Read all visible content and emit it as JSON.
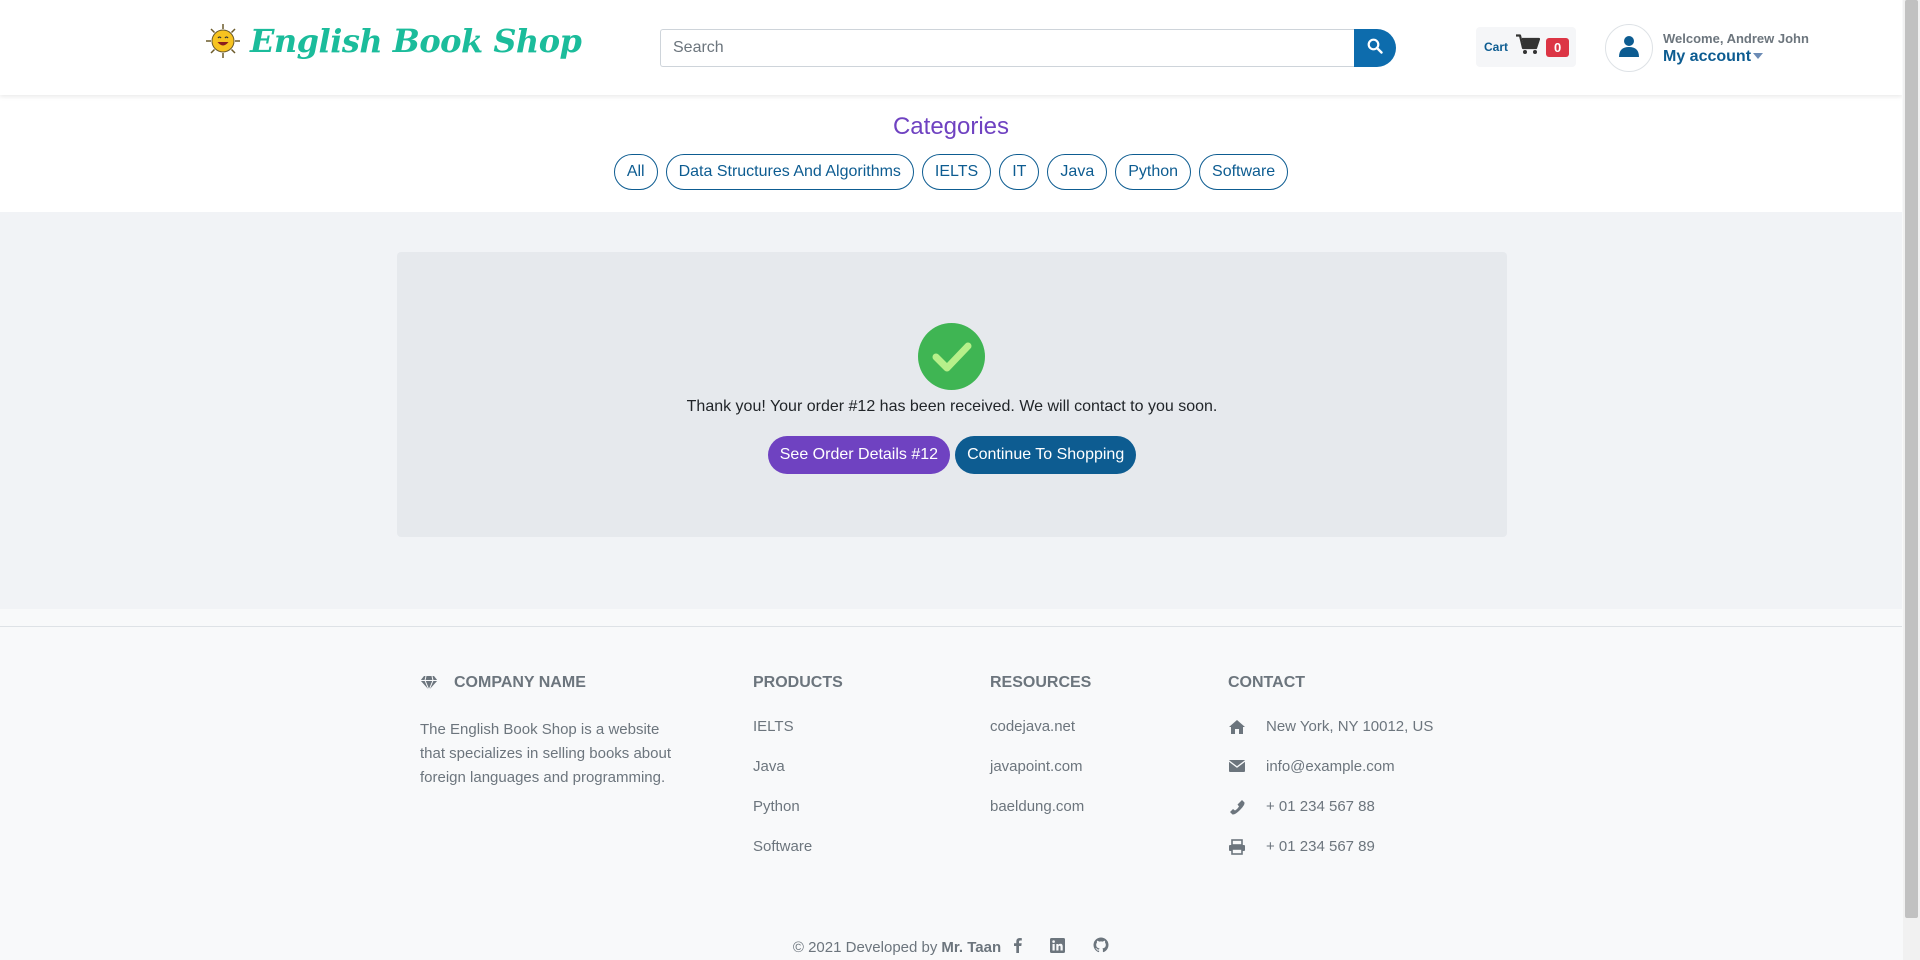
{
  "header": {
    "brand": "English Book Shop",
    "search_placeholder": "Search",
    "cart_label": "Cart",
    "cart_count": "0",
    "welcome": "Welcome, Andrew John",
    "my_account": "My account"
  },
  "categories": {
    "title": "Categories",
    "items": [
      "All",
      "Data Structures And Algorithms",
      "IELTS",
      "IT",
      "Java",
      "Python",
      "Software"
    ]
  },
  "confirmation": {
    "message": "Thank you! Your order #12 has been received. We will contact to you soon.",
    "details_button": "See Order Details #12",
    "continue_button": "Continue To Shopping"
  },
  "footer": {
    "company_heading": "COMPANY NAME",
    "company_text": "The English Book Shop is a website that specializes in selling books about foreign languages and programming.",
    "products_heading": "PRODUCTS",
    "products": [
      "IELTS",
      "Java",
      "Python",
      "Software"
    ],
    "resources_heading": "RESOURCES",
    "resources": [
      "codejava.net",
      "javapoint.com",
      "baeldung.com"
    ],
    "contact_heading": "CONTACT",
    "contact": {
      "address": "New York, NY 10012, US",
      "email": "info@example.com",
      "phone": "+ 01 234 567 88",
      "fax": "+ 01 234 567 89"
    },
    "copyright_prefix": "© 2021 Developed by",
    "developer": "Mr. Taan"
  },
  "colors": {
    "brand": "#1bbc9b",
    "primary": "#0d5c91",
    "purple": "#6f42c1",
    "success": "#3fb553",
    "danger": "#dc3545"
  },
  "icons": [
    "sun-logo-icon",
    "search-icon",
    "cart-icon",
    "user-icon",
    "check-icon",
    "diamond-icon",
    "home-icon",
    "envelope-icon",
    "phone-icon",
    "printer-icon",
    "facebook-icon",
    "linkedin-icon",
    "github-icon"
  ]
}
